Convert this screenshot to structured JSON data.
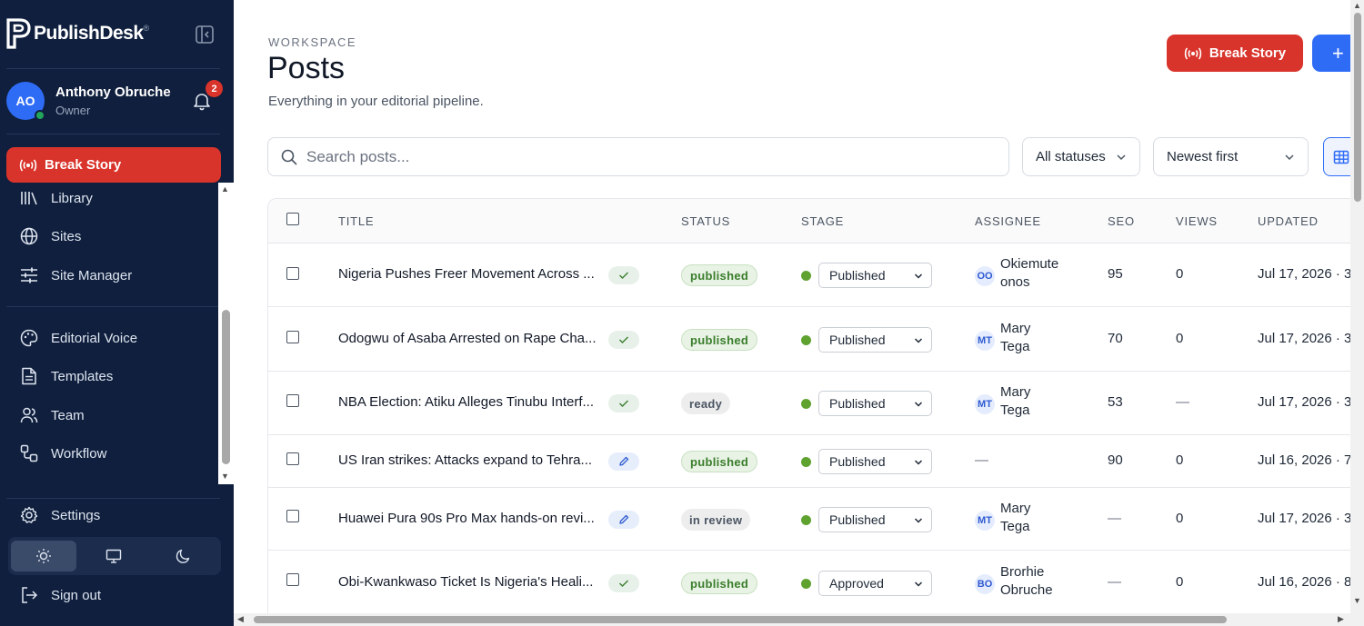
{
  "app": {
    "brand": "PublishDesk",
    "trademark": "®"
  },
  "user": {
    "initials": "AO",
    "name": "Anthony Obruche",
    "role": "Owner",
    "notifications": "2"
  },
  "sidebar": {
    "break_story": "Break Story",
    "items": [
      {
        "label": "Library",
        "icon": "library-icon"
      },
      {
        "label": "Sites",
        "icon": "globe-icon"
      },
      {
        "label": "Site Manager",
        "icon": "sliders-icon"
      },
      {
        "label": "Editorial Voice",
        "icon": "palette-icon"
      },
      {
        "label": "Templates",
        "icon": "document-icon"
      },
      {
        "label": "Team",
        "icon": "users-icon"
      },
      {
        "label": "Workflow",
        "icon": "workflow-icon"
      }
    ],
    "settings": "Settings",
    "sign_out": "Sign out",
    "theme_active": "light"
  },
  "header": {
    "eyebrow": "WORKSPACE",
    "title": "Posts",
    "subtitle": "Everything in your editorial pipeline.",
    "break_story": "Break Story",
    "new_label": "+"
  },
  "filters": {
    "search_placeholder": "Search posts...",
    "status": "All statuses",
    "sort": "Newest first"
  },
  "table": {
    "columns": [
      "TITLE",
      "STATUS",
      "STAGE",
      "ASSIGNEE",
      "SEO",
      "VIEWS",
      "UPDATED"
    ],
    "rows": [
      {
        "title": "Nigeria Pushes Freer Movement Across ...",
        "chip": "check",
        "status": "published",
        "stage": "Published",
        "assignee_initials": "OO",
        "assignee_line1": "Okiemute",
        "assignee_line2": "onos",
        "seo": "95",
        "views": "0",
        "updated": "Jul 17, 2026 · 3"
      },
      {
        "title": "Odogwu of Asaba Arrested on Rape Cha...",
        "chip": "check",
        "status": "published",
        "stage": "Published",
        "assignee_initials": "MT",
        "assignee_line1": "Mary",
        "assignee_line2": "Tega",
        "seo": "70",
        "views": "0",
        "updated": "Jul 17, 2026 · 3"
      },
      {
        "title": "NBA Election: Atiku Alleges Tinubu Interf...",
        "chip": "check",
        "status": "ready",
        "stage": "Published",
        "assignee_initials": "MT",
        "assignee_line1": "Mary",
        "assignee_line2": "Tega",
        "seo": "53",
        "views": "—",
        "updated": "Jul 17, 2026 · 3"
      },
      {
        "title": "US Iran strikes: Attacks expand to Tehra...",
        "chip": "edit",
        "status": "published",
        "stage": "Published",
        "assignee_initials": "",
        "assignee_line1": "—",
        "assignee_line2": "",
        "seo": "90",
        "views": "0",
        "updated": "Jul 16, 2026 · 7"
      },
      {
        "title": "Huawei Pura 90s Pro Max hands-on revi...",
        "chip": "edit",
        "status": "in review",
        "stage": "Published",
        "assignee_initials": "MT",
        "assignee_line1": "Mary",
        "assignee_line2": "Tega",
        "seo": "—",
        "views": "0",
        "updated": "Jul 17, 2026 · 3"
      },
      {
        "title": "Obi-Kwankwaso Ticket Is Nigeria's Heali...",
        "chip": "check",
        "status": "published",
        "stage": "Approved",
        "assignee_initials": "BO",
        "assignee_line1": "Brorhie",
        "assignee_line2": "Obruche",
        "seo": "—",
        "views": "0",
        "updated": "Jul 16, 2026 · 8"
      }
    ]
  },
  "colors": {
    "sidebar_bg": "#0f1f3d",
    "accent_red": "#d9342b",
    "accent_blue": "#2f6cf6",
    "stage_green": "#5fa230"
  }
}
